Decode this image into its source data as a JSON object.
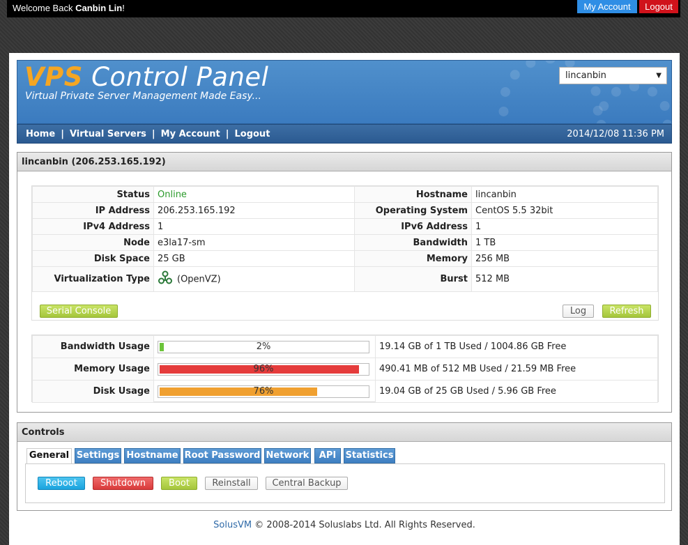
{
  "topbar": {
    "welcome_prefix": "Welcome Back ",
    "user_name": "Canbin Lin",
    "welcome_suffix": "!",
    "my_account": "My Account",
    "logout": "Logout"
  },
  "banner": {
    "title_vps": "VPS",
    "title_rest": " Control Panel",
    "subtitle": "Virtual Private Server Management Made Easy...",
    "server_select": "lincanbin"
  },
  "nav": {
    "items": [
      "Home",
      "Virtual Servers",
      "My Account",
      "Logout"
    ],
    "separator": "|",
    "datetime": "2014/12/08 11:36 PM"
  },
  "server": {
    "header": "lincanbin (206.253.165.192)",
    "left": [
      {
        "label": "Status",
        "value": "Online"
      },
      {
        "label": "IP Address",
        "value": "206.253.165.192"
      },
      {
        "label": "IPv4 Address",
        "value": "1"
      },
      {
        "label": "Node",
        "value": "e3la17-sm"
      },
      {
        "label": "Disk Space",
        "value": "25 GB"
      },
      {
        "label": "Virtualization Type",
        "value": "(OpenVZ)"
      }
    ],
    "right": [
      {
        "label": "Hostname",
        "value": "lincanbin"
      },
      {
        "label": "Operating System",
        "value": "CentOS 5.5 32bit"
      },
      {
        "label": "IPv6 Address",
        "value": "1"
      },
      {
        "label": "Bandwidth",
        "value": "1 TB"
      },
      {
        "label": "Memory",
        "value": "256 MB"
      },
      {
        "label": "Burst",
        "value": "512 MB"
      }
    ],
    "buttons": {
      "serial_console": "Serial Console",
      "log": "Log",
      "refresh": "Refresh"
    }
  },
  "usage": [
    {
      "label": "Bandwidth Usage",
      "percent": 2,
      "percent_text": "2%",
      "detail": "19.14 GB of 1 TB Used / 1004.86 GB Free"
    },
    {
      "label": "Memory Usage",
      "percent": 96,
      "percent_text": "96%",
      "detail": "490.41 MB of 512 MB Used / 21.59 MB Free"
    },
    {
      "label": "Disk Usage",
      "percent": 76,
      "percent_text": "76%",
      "detail": "19.04 GB of 25 GB Used / 5.96 GB Free"
    }
  ],
  "controls": {
    "header": "Controls",
    "tabs": [
      "General",
      "Settings",
      "Hostname",
      "Root Password",
      "Network",
      "API",
      "Statistics"
    ],
    "active_tab": "General",
    "actions": [
      "Reboot",
      "Shutdown",
      "Boot",
      "Reinstall",
      "Central Backup"
    ]
  },
  "footer": {
    "brand": "SolusVM",
    "text": " © 2008-2014 Soluslabs Ltd. All Rights Reserved."
  },
  "colors": {
    "online": "#2a9a2a",
    "accent_blue": "#2f8ee5",
    "logout_red": "#d0121b",
    "bar_green": "#6cc43a",
    "bar_red": "#e53c3c",
    "bar_orange": "#f0a030"
  }
}
